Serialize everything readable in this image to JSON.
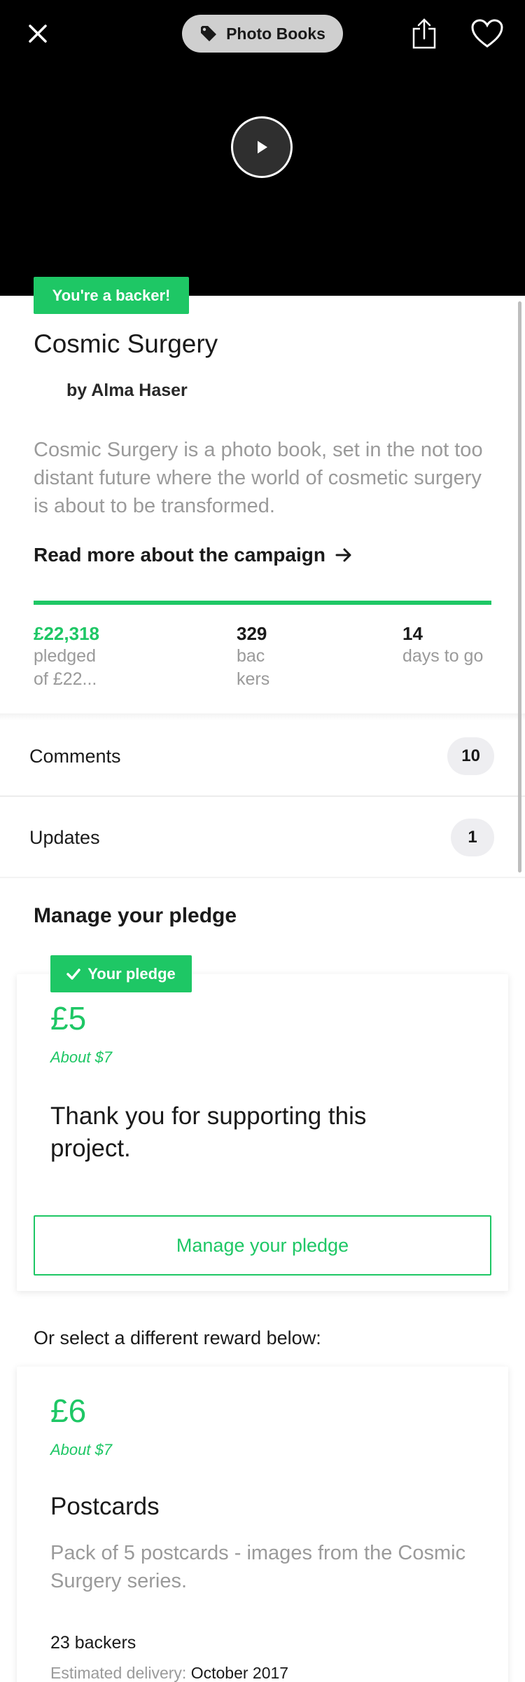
{
  "header": {
    "category_label": "Photo Books",
    "close_icon": "close-icon",
    "tag_icon": "tag-icon",
    "share_icon": "share-icon",
    "heart_icon": "heart-icon",
    "play_icon": "play-icon"
  },
  "project": {
    "backer_badge": "You're a backer!",
    "title": "Cosmic Surgery",
    "creator": "by Alma Haser",
    "blurb": "Cosmic Surgery is a photo book, set in the not too distant future where the world of cosmetic surgery is about to be transformed.",
    "read_more": "Read more about the campaign",
    "progress_fraction": 1.0
  },
  "stats": {
    "pledged_value": "£22,318",
    "pledged_label_1": "pledged",
    "pledged_label_2": "of £22...",
    "backers_value": "329",
    "backers_label_1": "bac",
    "backers_label_2": "kers",
    "days_value": "14",
    "days_label": "days to go"
  },
  "rows": {
    "comments_label": "Comments",
    "comments_count": "10",
    "updates_label": "Updates",
    "updates_count": "1"
  },
  "pledge": {
    "heading": "Manage your pledge",
    "badge": "Your pledge",
    "amount": "£5",
    "about": "About $7",
    "thanks": "Thank you for supporting this project.",
    "button": "Manage your pledge"
  },
  "rewards": {
    "intro": "Or select a different reward below:",
    "items": [
      {
        "amount": "£6",
        "about": "About $7",
        "title": "Postcards",
        "description": "Pack of 5 postcards - images from the Cosmic Surgery series.",
        "backers": "23 backers",
        "delivery_label": "Estimated delivery:",
        "delivery_value": "October 2017"
      }
    ]
  },
  "colors": {
    "accent": "#1ec765",
    "muted_text": "#9a9a9a",
    "hero_bg": "#000000"
  }
}
